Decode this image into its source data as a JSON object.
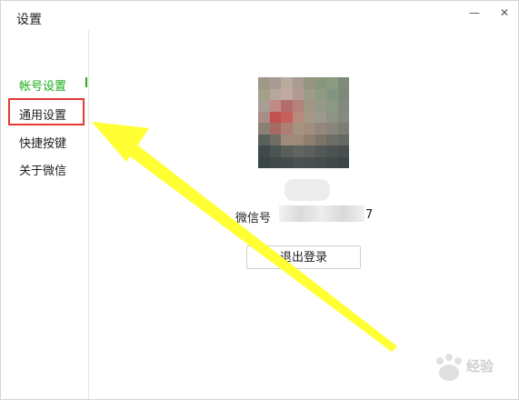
{
  "window": {
    "title": "设置",
    "minimize_icon": "minimize-icon",
    "close_icon": "close-icon"
  },
  "sidebar": {
    "items": [
      {
        "label": "帐号设置",
        "active": true
      },
      {
        "label": "通用设置",
        "active": false
      },
      {
        "label": "快捷按键",
        "active": false
      },
      {
        "label": "关于微信",
        "active": false
      }
    ]
  },
  "account": {
    "wechat_id_label": "微信号",
    "wechat_id_tail": "7",
    "logout_label": "退出登录"
  },
  "watermark": {
    "text": "经验"
  },
  "colors": {
    "accent": "#1aad19",
    "annotation_box": "#e53935",
    "annotation_arrow": "#ffff33"
  }
}
